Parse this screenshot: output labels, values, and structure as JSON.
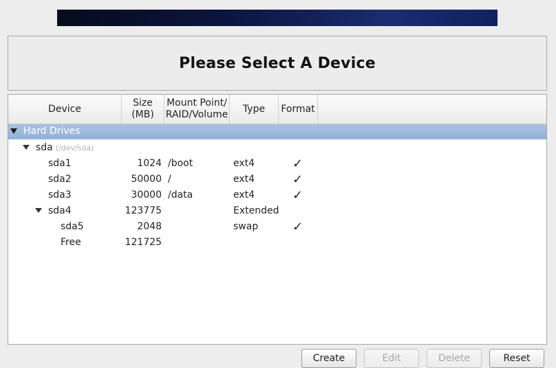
{
  "title": "Please Select A Device",
  "columns": {
    "device": "Device",
    "size_line1": "Size",
    "size_line2": "(MB)",
    "mount_line1": "Mount Point/",
    "mount_line2": "RAID/Volume",
    "type": "Type",
    "format": "Format"
  },
  "tree": {
    "group_label": "Hard Drives",
    "disk": {
      "name": "sda",
      "path": "(/dev/sda)"
    },
    "rows": [
      {
        "device": "sda1",
        "size": "1024",
        "mount": "/boot",
        "type": "ext4",
        "format": true
      },
      {
        "device": "sda2",
        "size": "50000",
        "mount": "/",
        "type": "ext4",
        "format": true
      },
      {
        "device": "sda3",
        "size": "30000",
        "mount": "/data",
        "type": "ext4",
        "format": true
      },
      {
        "device": "sda4",
        "size": "123775",
        "mount": "",
        "type": "Extended",
        "format": false
      },
      {
        "device": "sda5",
        "size": "2048",
        "mount": "",
        "type": "swap",
        "format": true
      },
      {
        "device": "Free",
        "size": "121725",
        "mount": "",
        "type": "",
        "format": false
      }
    ]
  },
  "check_glyph": "✓",
  "buttons": {
    "create": "Create",
    "edit": "Edit",
    "delete": "Delete",
    "reset": "Reset"
  }
}
